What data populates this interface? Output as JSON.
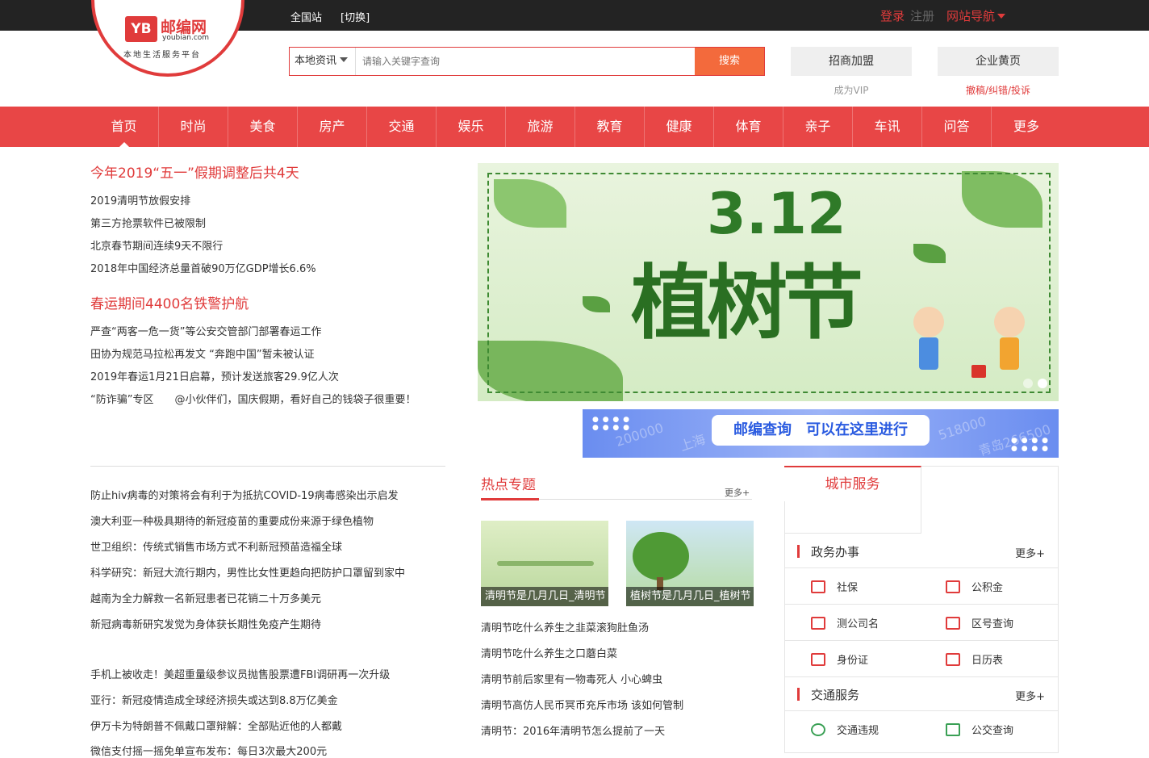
{
  "topbar": {
    "city": "全国站",
    "switch": "[切换]",
    "login": "登录",
    "register": "注册",
    "site_nav": "网站导航"
  },
  "logo": {
    "mark": "YB",
    "name": "邮编网",
    "domain": "youbian.com",
    "slogan": "本地生活服务平台"
  },
  "search": {
    "category": "本地资讯",
    "placeholder": "请输入关键字查询",
    "button": "搜索"
  },
  "top_buttons": [
    {
      "label": "招商加盟",
      "sub": "成为VIP"
    },
    {
      "label": "企业黄页",
      "sub": "撤稿/纠错/投诉"
    }
  ],
  "nav": [
    "首页",
    "时尚",
    "美食",
    "房产",
    "交通",
    "娱乐",
    "旅游",
    "教育",
    "健康",
    "体育",
    "亲子",
    "车讯",
    "问答",
    "更多"
  ],
  "headlines": [
    {
      "title": "今年2019“五一”假期调整后共4天",
      "items": [
        "2019清明节放假安排",
        "第三方抢票软件已被限制",
        "北京春节期间连续9天不限行",
        "2018年中国经济总量首破90万亿GDP增长6.6%"
      ]
    },
    {
      "title": "春运期间4400名铁警护航",
      "items": [
        "严查“两客一危一货”等公安交管部门部署春运工作",
        "田协为规范马拉松再发文 “奔跑中国”暂未被认证",
        "2019年春运1月21日启幕，预计发送旅客29.9亿人次",
        "“防诈骗”专区　　@小伙伴们，国庆假期，看好自己的钱袋子很重要！"
      ]
    }
  ],
  "banner": {
    "date": "3.12",
    "title": "植树节"
  },
  "strip": {
    "text": "邮编查询　可以在这里进行",
    "ghost1": "200000",
    "ghost2": "518000",
    "ghost3": "266500",
    "ghost4": "上海",
    "ghost5": "青岛"
  },
  "news_list_1": [
    "防止hiv病毒的对策将会有利于为抵抗COVID-19病毒感染出示启发",
    "澳大利亚一种极具期待的新冠疫苗的重要成份来源于绿色植物",
    "世卫组织：传统式销售市场方式不利新冠预苗造福全球",
    "科学研究：新冠大流行期内，男性比女性更趋向把防护口罩留到家中",
    "越南为全力解救一名新冠患者已花销二十万多美元",
    "新冠病毒新研究发觉为身体获长期性免疫产生期待"
  ],
  "news_list_2": [
    "手机上被收走！美超重量级参议员抛售股票遭FBI调研再一次升级",
    "亚行：新冠疫情造成全球经济损失或达到8.8万亿美金",
    "伊万卡为特朗普不佩戴口罩辩解：全部贴近他的人都戴",
    "微信支付摇一摇免单宣布发布：每日3次最大200元"
  ],
  "hot": {
    "title": "热点专题",
    "more": "更多+",
    "thumbs": [
      "清明节是几月几日_清明节",
      "植树节是几月几日_植树节"
    ],
    "items": [
      "清明节吃什么养生之韭菜滚狗肚鱼汤",
      "清明节吃什么养生之口蘑白菜",
      "清明节前后家里有一物毒死人 小心蜱虫",
      "清明节高仿人民币冥币充斥市场 该如何管制",
      "清明节：2016年清明节怎么提前了一天"
    ]
  },
  "city_service": {
    "tab": "城市服务",
    "sections": [
      {
        "title": "政务办事",
        "more": "更多+",
        "items": [
          "社保",
          "公积金",
          "测公司名",
          "区号查询",
          "身份证",
          "日历表"
        ]
      },
      {
        "title": "交通服务",
        "more": "更多+",
        "items": [
          "交通违规",
          "公交查询"
        ]
      }
    ]
  },
  "colors": {
    "accent": "#e03b3b",
    "nav": "#e84646",
    "search_btn": "#f36a3c"
  }
}
